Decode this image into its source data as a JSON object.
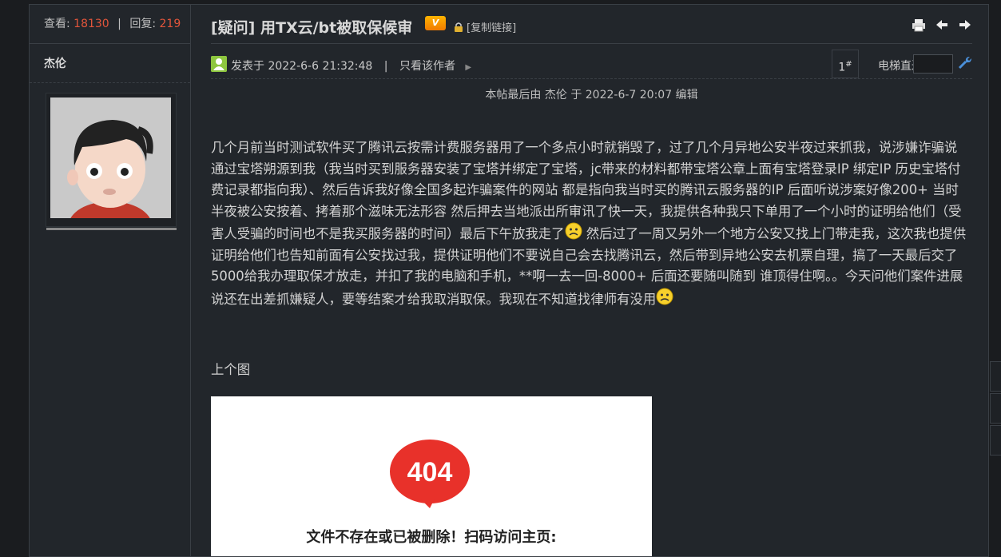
{
  "stats": {
    "views_label": "查看:",
    "views": "18130",
    "replies_label": "回复:",
    "replies": "219"
  },
  "author": {
    "name": "杰伦"
  },
  "thread": {
    "title": "[疑问] 用TX云/bt被取保候审",
    "badge": "V",
    "copy_link": "[复制链接]"
  },
  "post": {
    "posted_label": "发表于 2022-6-6 21:32:48",
    "pipe": "|",
    "only_author": "只看该作者",
    "floor": "1",
    "floor_sup": "#",
    "elevator_label": "电梯直达",
    "edit_note": "本帖最后由 杰伦 于 2022-6-7 20:07 编辑",
    "para1": "几个月前当时测试软件买了腾讯云按需计费服务器用了一个多点小时就销毁了，过了几个月异地公安半夜过来抓我，说涉嫌诈骗说通过宝塔朔源到我（我当时买到服务器安装了宝塔并绑定了宝塔，jc带来的材料都带宝塔公章上面有宝塔登录IP 绑定IP 历史宝塔付费记录都指向我）、然后告诉我好像全国多起诈骗案件的网站 都是指向我当时买的腾讯云服务器的IP 后面听说涉案好像200+ 当时半夜被公安按着、拷着那个滋味无法形容  然后押去当地派出所审讯了快一天，我提供各种我只下单用了一个小时的证明给他们（受害人受骗的时间也不是我买服务器的时间）最后下午放我走了",
    "para2": " 然后过了一周又另外一个地方公安又找上门带走我，这次我也提供证明给他们也告知前面有公安找过我，提供证明他们不要说自己会去找腾讯云，然后带到异地公安去机票自理，搞了一天最后交了5000给我办理取保才放走，并扣了我的电脑和手机，**啊一去一回-8000+ 后面还要随叫随到 谁顶得住啊。。今天问他们案件进展说还在出差抓嫌疑人，要等结案才给我取消取保。我现在不知道找律师有没用",
    "image_caption": "上个图",
    "image_404": "404",
    "image_text": "文件不存在或已被删除！扫码访问主页:"
  },
  "colors": {
    "accent": "#e2553b",
    "background": "#22262b",
    "error_red": "#e8312a"
  }
}
